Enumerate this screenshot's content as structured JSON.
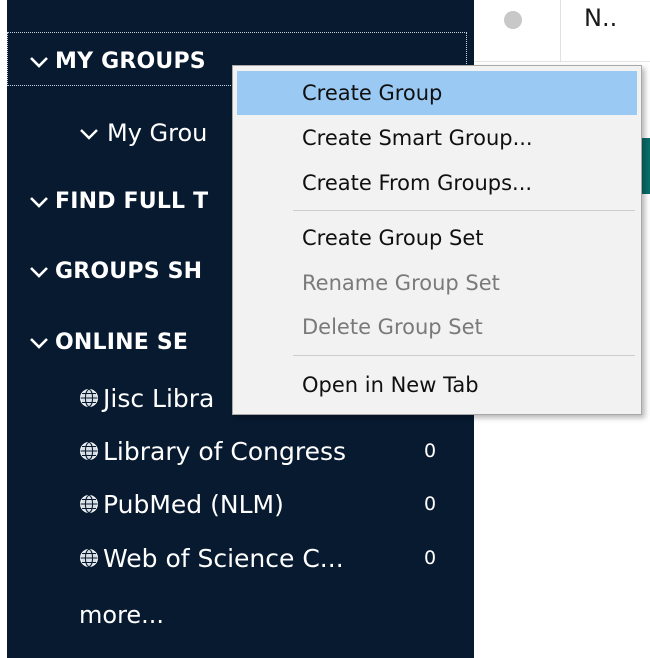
{
  "sidebar": {
    "sections": {
      "my_groups": "MY GROUPS",
      "find_full_text": "FIND FULL T",
      "groups_shared": "GROUPS SH",
      "online_search": "ONLINE SE"
    },
    "my_groups_sub": "My Grou",
    "online_items": [
      {
        "label": "Jisc Libra",
        "count": ""
      },
      {
        "label": "Library of Congress",
        "count": "0"
      },
      {
        "label": "PubMed (NLM)",
        "count": "0"
      },
      {
        "label": "Web of Science C...",
        "count": "0"
      }
    ],
    "more": "more..."
  },
  "content": {
    "column_title": "N.."
  },
  "context_menu": {
    "items": [
      {
        "label": "Create Group",
        "enabled": true,
        "highlighted": true
      },
      {
        "label": "Create Smart Group...",
        "enabled": true
      },
      {
        "label": "Create From Groups...",
        "enabled": true
      },
      {
        "label": "Create Group Set",
        "enabled": true
      },
      {
        "label": "Rename Group Set",
        "enabled": false
      },
      {
        "label": "Delete Group Set",
        "enabled": false
      },
      {
        "label": "Open in New Tab",
        "enabled": true
      }
    ]
  },
  "icons": {
    "section_toggle": "chevron-down-icon",
    "online_source": "globe-icon",
    "status": "circle-icon"
  },
  "colors": {
    "sidebar_bg": "#071a30",
    "menu_bg": "#f2f2f2",
    "menu_highlight": "#9ac9f4",
    "menu_disabled_text": "#7a7a7a",
    "accent_teal": "#0b6e68"
  }
}
